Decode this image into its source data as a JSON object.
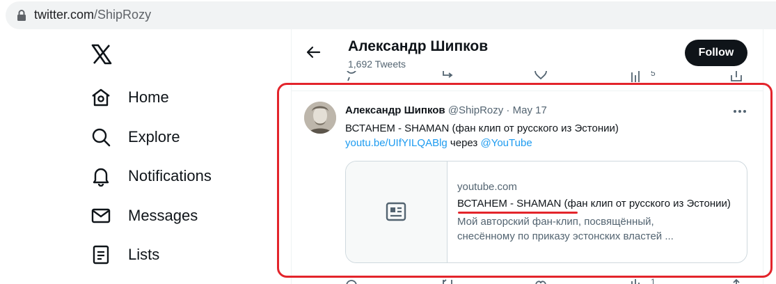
{
  "browser": {
    "url_host": "twitter.com",
    "url_path": "/ShipRozy"
  },
  "nav": {
    "items": [
      {
        "label": "Home",
        "icon": "home-icon"
      },
      {
        "label": "Explore",
        "icon": "search-icon"
      },
      {
        "label": "Notifications",
        "icon": "bell-icon"
      },
      {
        "label": "Messages",
        "icon": "envelope-icon"
      },
      {
        "label": "Lists",
        "icon": "list-icon"
      }
    ]
  },
  "header": {
    "name": "Александр Шипков",
    "tweet_count": "1,692 Tweets",
    "follow_label": "Follow"
  },
  "prev_tweet_actions": {
    "views": "5"
  },
  "tweet": {
    "author_name": "Александр Шипков",
    "handle": "@ShipRozy",
    "separator": " · ",
    "date": "May 17",
    "text": "ВСТАНЕМ - SHAMAN (фан клип от русского из Эстонии)",
    "link": "youtu.be/UIfYILQABlg",
    "via": " через ",
    "mention": "@YouTube",
    "card": {
      "domain": "youtube.com",
      "title": "ВСТАНЕМ - SHAMAN (фан клип от русского из Эстонии)",
      "desc_line1": "Мой авторский фан-клип, посвящённый,",
      "desc_line2": "снесённому по приказу эстонских властей ..."
    }
  },
  "next_tweet_actions": {
    "views": "1"
  },
  "colors": {
    "accent": "#1d9bf0",
    "highlight": "#e3242b",
    "text": "#0f1419",
    "muted": "#536471"
  }
}
